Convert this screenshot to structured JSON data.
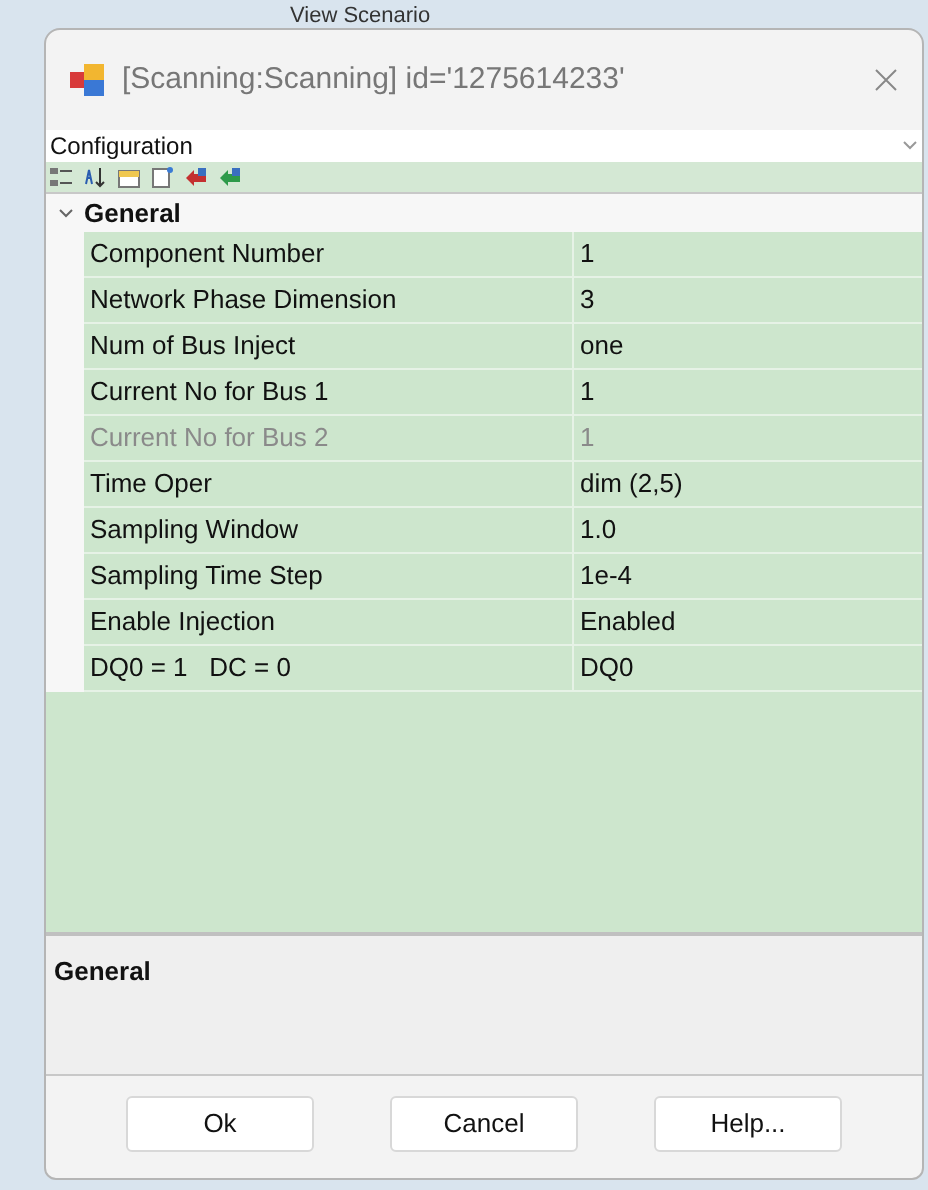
{
  "background": {
    "tab_label": "View Scenario"
  },
  "window": {
    "title": "[Scanning:Scanning] id='1275614233'"
  },
  "object_selector": {
    "value": "Configuration"
  },
  "toolbar": [
    {
      "kind": "categorized"
    },
    {
      "kind": "alphabetical"
    },
    {
      "kind": "properties"
    },
    {
      "kind": "pages"
    },
    {
      "kind": "red"
    },
    {
      "kind": "green"
    }
  ],
  "category": {
    "name": "General",
    "expanded": true,
    "properties": [
      {
        "name": "Component Number",
        "value": "1",
        "disabled": false
      },
      {
        "name": "Network Phase Dimension",
        "value": "3",
        "disabled": false
      },
      {
        "name": "Num of Bus Inject",
        "value": "one",
        "disabled": false
      },
      {
        "name": "Current No for Bus 1",
        "value": "1",
        "disabled": false
      },
      {
        "name": "Current No for Bus 2",
        "value": "1",
        "disabled": true
      },
      {
        "name": "Time Oper",
        "value": "dim (2,5)",
        "disabled": false
      },
      {
        "name": "Sampling Window",
        "value": "1.0",
        "disabled": false
      },
      {
        "name": "Sampling Time Step",
        "value": "1e-4",
        "disabled": false
      },
      {
        "name": "Enable Injection",
        "value": "Enabled",
        "disabled": false
      },
      {
        "name": "DQ0 = 1   DC = 0",
        "value": "DQ0",
        "disabled": false
      }
    ]
  },
  "description": {
    "title": "General"
  },
  "buttons": [
    "Ok",
    "Cancel",
    "Help..."
  ]
}
